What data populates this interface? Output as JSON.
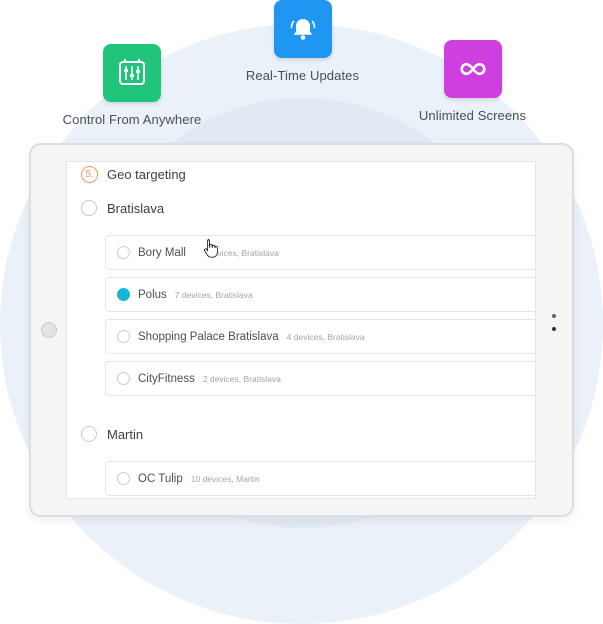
{
  "features": [
    {
      "label": "Control From Anywhere",
      "icon": "control-panel-icon",
      "color": "#20c47a"
    },
    {
      "label": "Real-Time Updates",
      "icon": "bell-icon",
      "color": "#1e96f2"
    },
    {
      "label": "Unlimited Screens",
      "icon": "infinity-icon",
      "color": "#cf3fe0"
    }
  ],
  "section": {
    "step": "5.",
    "title": "Geo targeting",
    "accent": "#f09b66"
  },
  "cities": [
    {
      "name": "Bratislava",
      "locations": [
        {
          "name": "Bory Mall",
          "meta": "devices, Bratislava",
          "selected": false
        },
        {
          "name": "Polus",
          "meta": "7 devices, Bratislava",
          "selected": true
        },
        {
          "name": "Shopping Palace Bratislava",
          "meta": "4 devices, Bratislava",
          "selected": false
        },
        {
          "name": "CityFitness",
          "meta": "2 devices, Bratislava",
          "selected": false
        }
      ]
    },
    {
      "name": "Martin",
      "locations": [
        {
          "name": "OC Tulip",
          "meta": "10 devices, Martin",
          "selected": false
        }
      ]
    }
  ],
  "selection_color": "#16b6d6"
}
